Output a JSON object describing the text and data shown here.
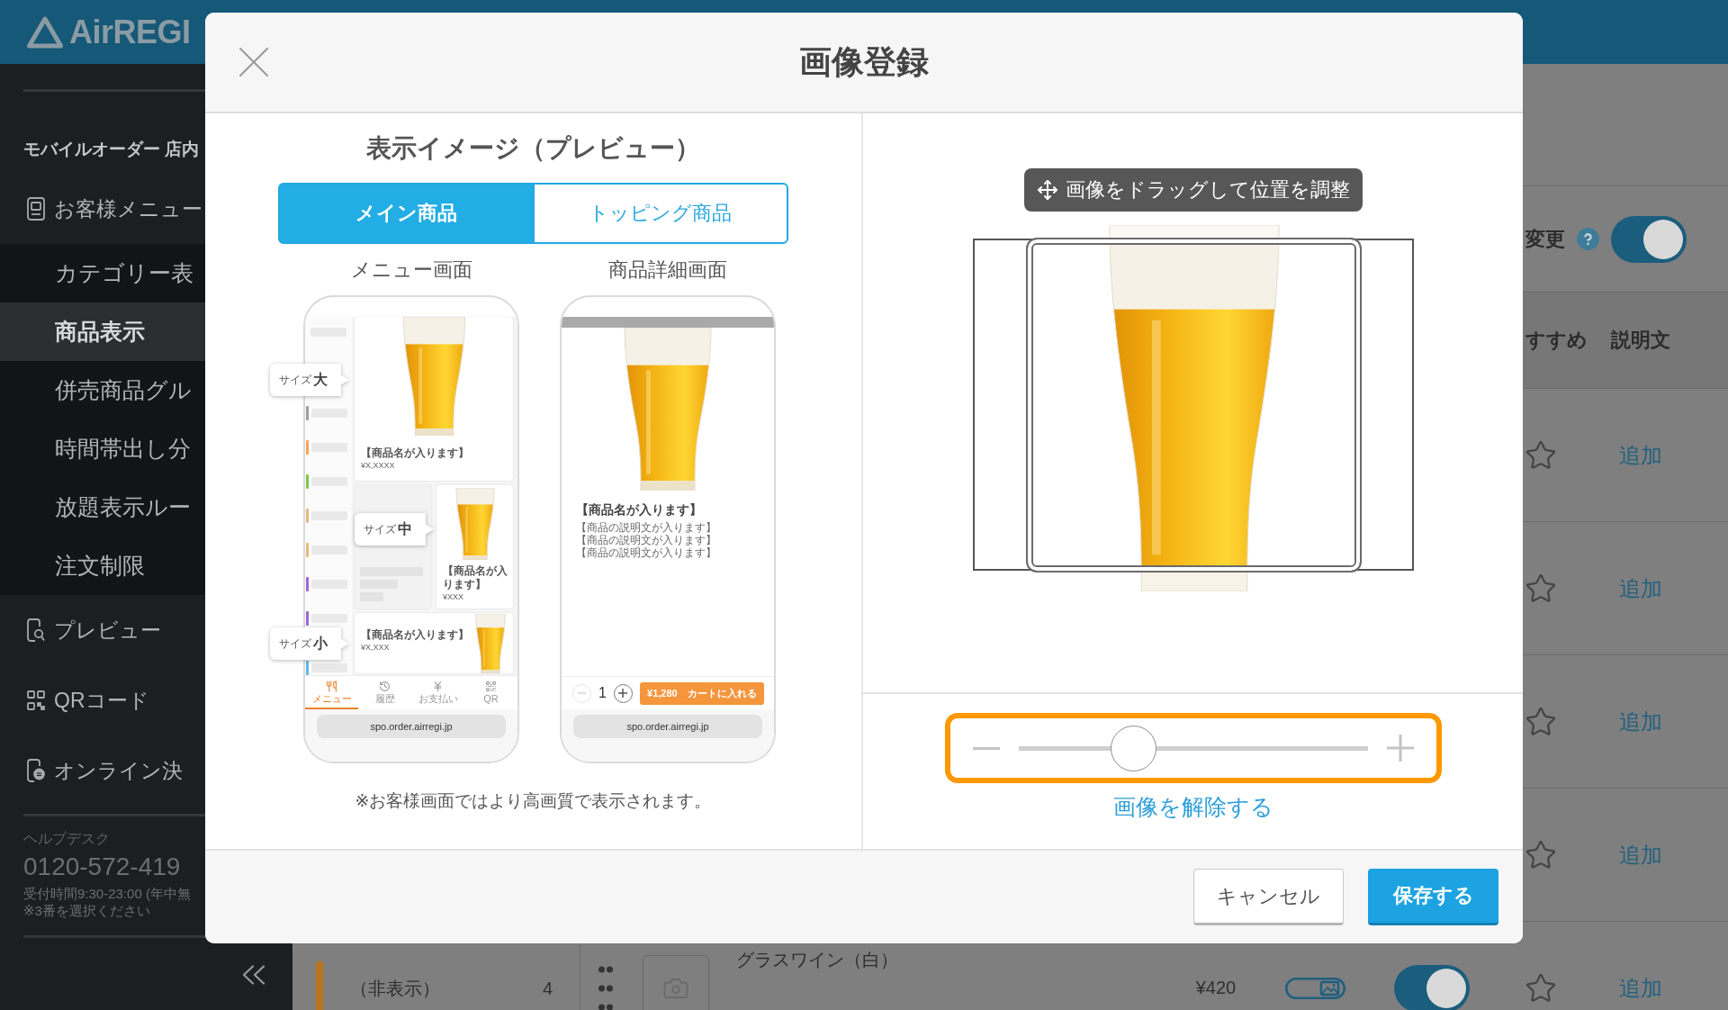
{
  "header": {
    "logo": "AirREGI"
  },
  "sidebar": {
    "section_title": "モバイルオーダー 店内",
    "items": [
      {
        "kind": "menu",
        "label": "お客様メニュー",
        "selected": false,
        "children": [
          {
            "label": "カテゴリー表",
            "selected": false
          },
          {
            "label": "商品表示",
            "selected": true
          },
          {
            "label": "併売商品グル",
            "selected": false
          },
          {
            "label": "時間帯出し分",
            "selected": false
          },
          {
            "label": "放題表示ルー",
            "selected": false
          },
          {
            "label": "注文制限",
            "selected": false
          }
        ]
      },
      {
        "kind": "preview",
        "label": "プレビュー",
        "selected": false
      },
      {
        "kind": "qr",
        "label": "QRコード",
        "selected": false
      },
      {
        "kind": "payment",
        "label": "オンライン決",
        "selected": false
      }
    ],
    "helpdesk": {
      "title": "ヘルプデスク",
      "phone": "0120-572-419",
      "hours": "受付時間9:30-23:00 (年中無",
      "note": "※3番を選択ください"
    }
  },
  "page": {
    "categories": [
      {
        "name": "（非表示）",
        "count": "4",
        "color": "#b8741f"
      }
    ],
    "setting": {
      "label": "変更",
      "on": true
    },
    "table": {
      "columns": [
        {
          "kind": "recommend",
          "label": "すすめ"
        },
        {
          "kind": "description",
          "label": "説明文"
        }
      ],
      "rows": [
        {
          "recommended": false,
          "description": "追加"
        },
        {
          "recommended": false,
          "description": "追加"
        },
        {
          "recommended": false,
          "description": "追加"
        },
        {
          "recommended": false,
          "description": "追加"
        },
        {
          "name": "グラスワイン（白）",
          "price": "¥420",
          "on": true,
          "recommended": false,
          "description": "追加"
        }
      ]
    }
  },
  "modal": {
    "title": "画像登録",
    "preview": {
      "heading": "表示イメージ（プレビュー）",
      "tabs": [
        {
          "label": "メイン商品",
          "selected": true
        },
        {
          "label": "トッピング商品",
          "selected": false
        }
      ],
      "screens": [
        {
          "kind": "menu",
          "label": "メニュー画面",
          "categories": [
            {
              "color": "#9e9e9e"
            },
            {
              "color": "#f5a557"
            },
            {
              "color": "#7cc84a"
            },
            {
              "color": "#e8b87c"
            },
            {
              "color": "#e8b87c"
            },
            {
              "color": "#a366d3"
            },
            {
              "color": "#a366d3"
            },
            {
              "color": "#5cb9e9"
            }
          ],
          "cards": [
            {
              "kind": "large",
              "callout": "サイズ**大**",
              "name": "【商品名が入ります】",
              "price": "¥X,XXXX"
            },
            {
              "kind": "medium",
              "callout": "サイズ**中**",
              "name": "【商品名が入ります】",
              "price": "¥XXX"
            },
            {
              "kind": "small",
              "callout": "サイズ**小**",
              "name": "【商品名が入ります】",
              "price": "¥X,XXX"
            }
          ],
          "tab_bar": [
            {
              "kind": "menu",
              "label": "メニュー",
              "selected": true
            },
            {
              "kind": "history",
              "label": "履歴",
              "selected": false
            },
            {
              "kind": "payment",
              "label": "お支払い",
              "selected": false
            },
            {
              "kind": "qr",
              "label": "QR",
              "selected": false
            }
          ],
          "url": "spo.order.airregi.jp"
        },
        {
          "kind": "detail",
          "label": "商品詳細画面",
          "name": "【商品名が入ります】",
          "description": [
            "【商品の説明文が入ります】",
            "【商品の説明文が入ります】",
            "【商品の説明文が入ります】"
          ],
          "quantity": "1",
          "decrement_disabled": true,
          "cart_button": "¥1,280　カートに入れる",
          "url": "spo.order.airregi.jp"
        }
      ],
      "note": "※お客様画面ではより高画質で表示されます。"
    },
    "editor": {
      "hint": "画像をドラッグして位置を調整",
      "zoom": {
        "level": 0.33,
        "highlighted": true
      },
      "remove_link": "画像を解除する"
    },
    "buttons": [
      {
        "kind": "secondary",
        "label": "キャンセル"
      },
      {
        "kind": "primary",
        "label": "保存する"
      }
    ]
  }
}
